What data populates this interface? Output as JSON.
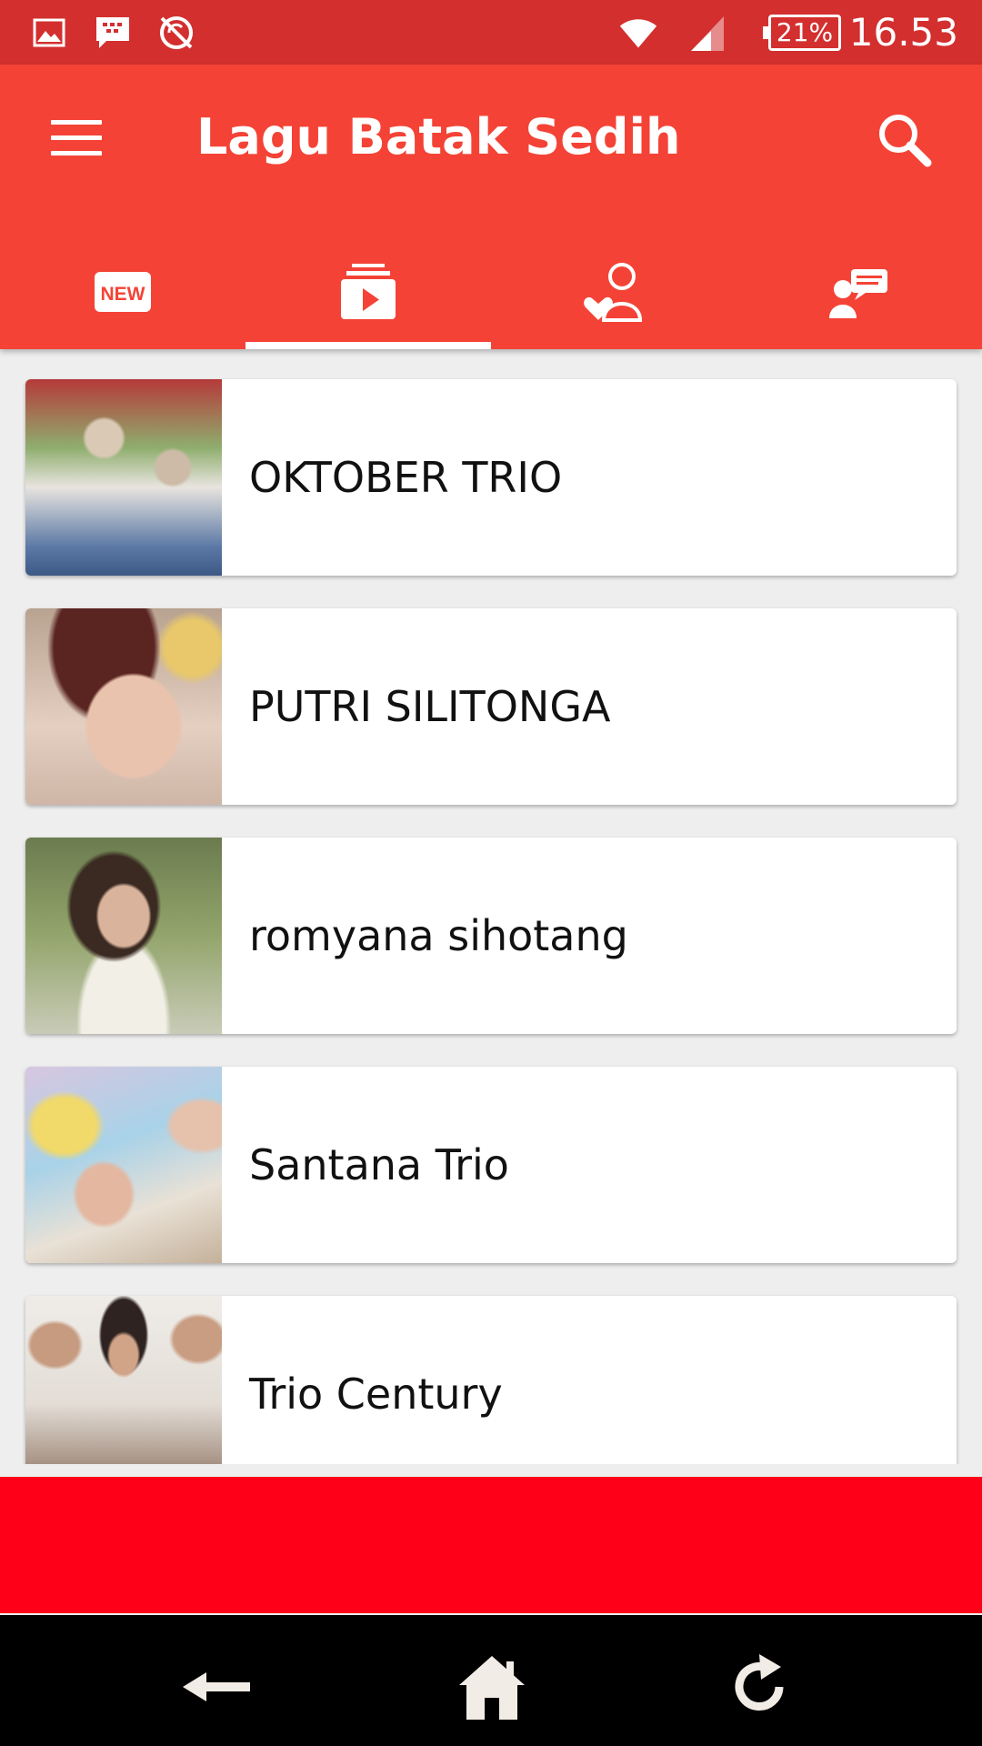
{
  "status_bar": {
    "battery": "21%",
    "time": "16.53",
    "icons": [
      "image-icon",
      "bbm-icon",
      "sync-disabled-icon",
      "wifi-icon",
      "signal-icon",
      "battery-icon"
    ]
  },
  "app_bar": {
    "title": "Lagu Batak Sedih",
    "menu_icon": "hamburger-menu-icon",
    "search_icon": "search-icon"
  },
  "tabs": [
    {
      "icon": "new-icon",
      "selected": false
    },
    {
      "icon": "video-playlist-icon",
      "selected": true
    },
    {
      "icon": "favorite-user-icon",
      "selected": false
    },
    {
      "icon": "chat-user-icon",
      "selected": false
    }
  ],
  "artists": [
    {
      "name": "OKTOBER TRIO"
    },
    {
      "name": "PUTRI SILITONGA"
    },
    {
      "name": "romyana sihotang"
    },
    {
      "name": "Santana Trio"
    },
    {
      "name": "Trio Century"
    }
  ],
  "nav_bar": {
    "icons": [
      "back-arrow-icon",
      "home-icon",
      "reload-icon"
    ]
  },
  "colors": {
    "status_bar": "#d32f2f",
    "app_bar": "#f44336",
    "banner": "#ff0019",
    "nav_bar": "#000000",
    "background": "#eeeeee"
  }
}
